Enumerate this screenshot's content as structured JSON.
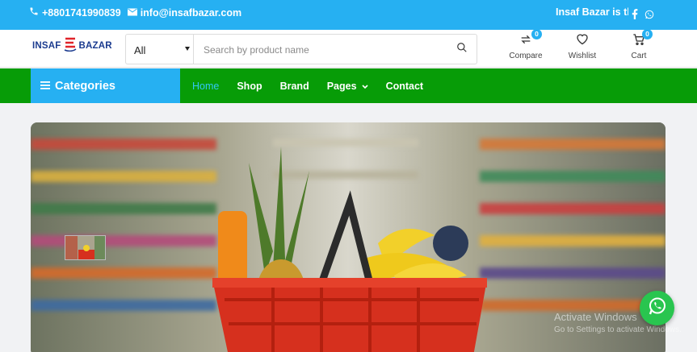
{
  "topbar": {
    "phone": "+8801741990839",
    "email": "info@insafbazar.com",
    "marquee": "Insaf Bazar is the l",
    "social_icons": [
      "facebook-icon",
      "whatsapp-icon"
    ]
  },
  "header": {
    "logo": {
      "left": "INSAF",
      "right": "BAZAR"
    },
    "search": {
      "category_value": "All",
      "placeholder": "Search by product name"
    },
    "compare": {
      "label": "Compare",
      "count": "0"
    },
    "wishlist": {
      "label": "Wishlist"
    },
    "cart": {
      "label": "Cart",
      "count": "0"
    }
  },
  "nav": {
    "categories_label": "Categories",
    "items": [
      {
        "label": "Home",
        "active": true
      },
      {
        "label": "Shop"
      },
      {
        "label": "Brand"
      },
      {
        "label": "Pages"
      },
      {
        "label": "Contact"
      }
    ]
  },
  "watermark": {
    "title": "Activate Windows",
    "subtitle": "Go to Settings to activate Windows."
  },
  "colors": {
    "topbar": "#26b0f2",
    "nav": "#079c07",
    "categories": "#26b0f2",
    "whatsapp": "#29c54f"
  }
}
